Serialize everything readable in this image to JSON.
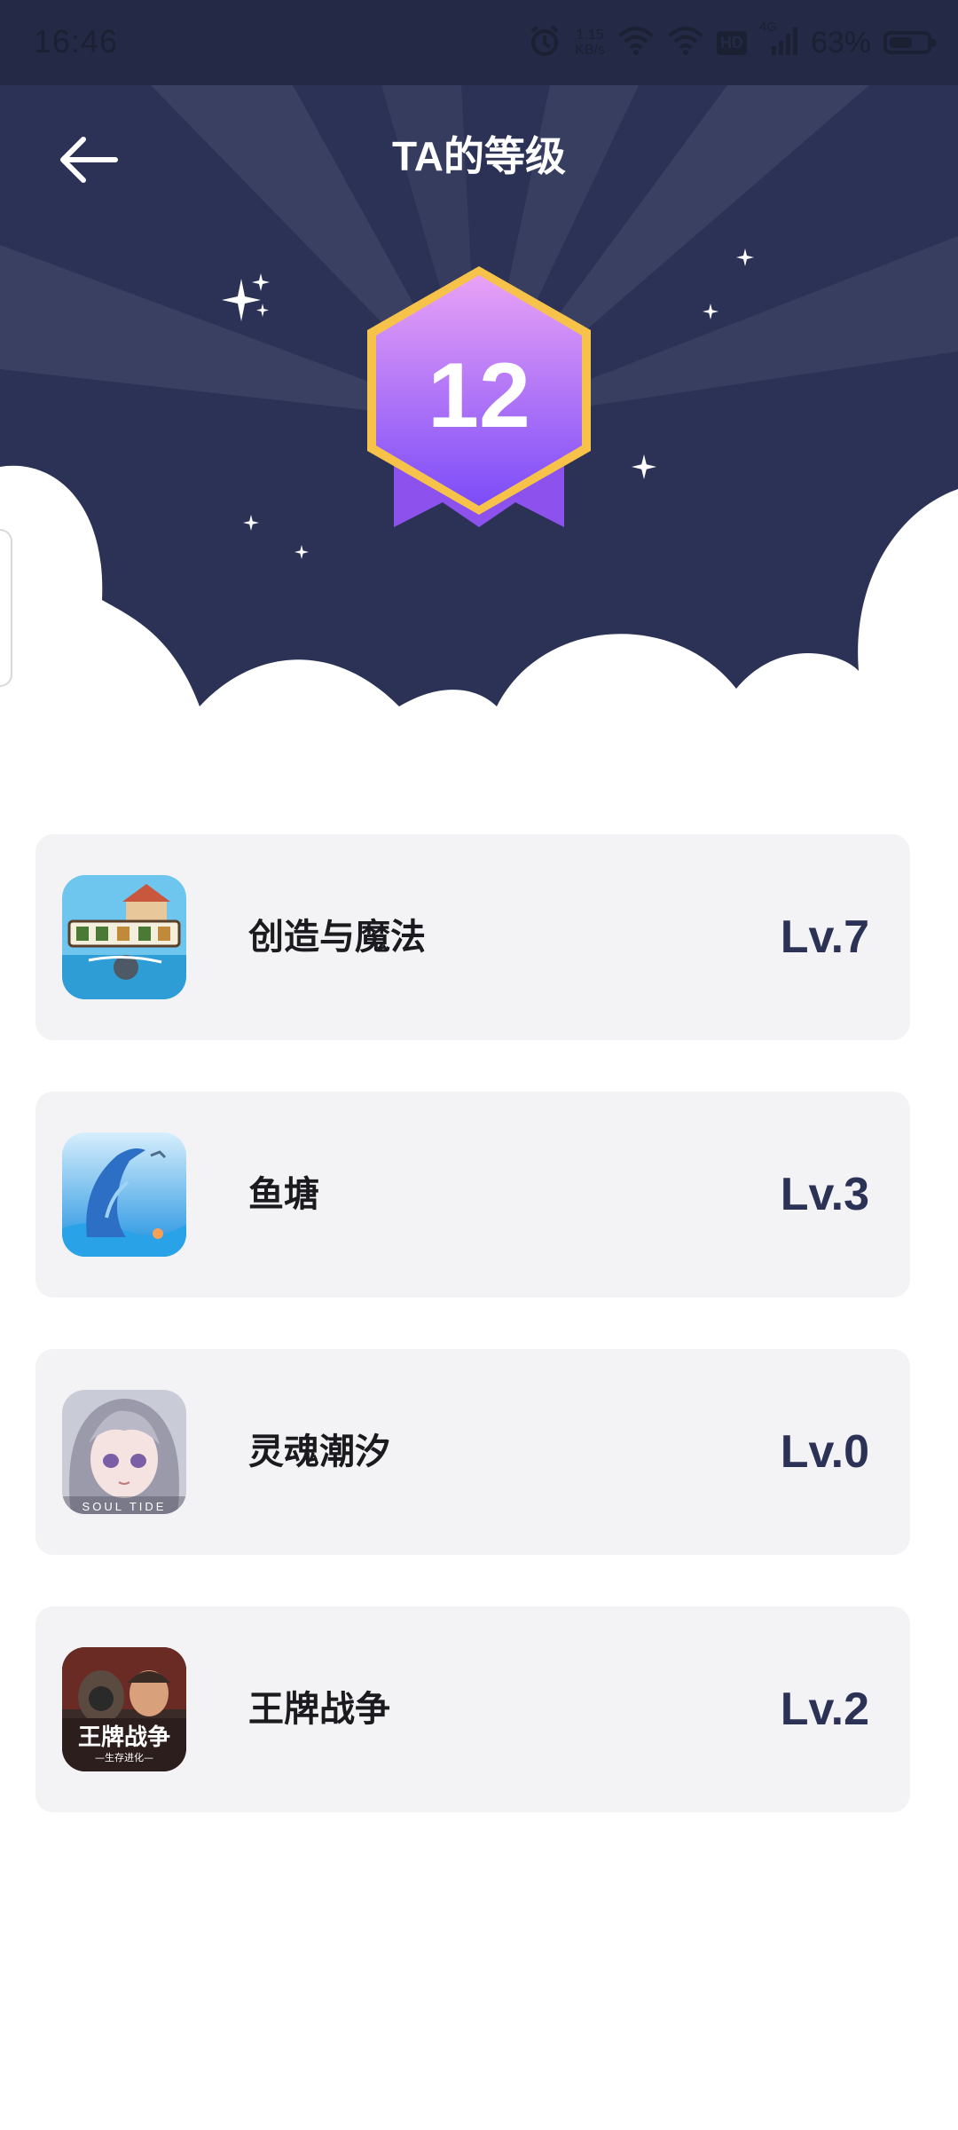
{
  "status_bar": {
    "time": "16:46",
    "network_speed_value": "1.15",
    "network_speed_unit": "KB/s",
    "hd_label": "HD",
    "signal_label": "4G",
    "battery_percent": "63%",
    "battery_level": 0.63
  },
  "header": {
    "title": "TA的等级",
    "back_icon": "arrow-left-icon",
    "level_badge": {
      "value": "12",
      "gradient_top": "#e79df7",
      "gradient_bottom": "#7b4dfa",
      "border_color": "#f8c449"
    },
    "background_color": "#2b3256"
  },
  "games": [
    {
      "name": "创造与魔法",
      "level": "Lv.7",
      "icon": "creation-and-magic-game-icon"
    },
    {
      "name": "鱼塘",
      "level": "Lv.3",
      "icon": "fish-pond-dolphin-game-icon"
    },
    {
      "name": "灵魂潮汐",
      "level": "Lv.0",
      "icon": "soul-tide-game-icon",
      "icon_caption": "SOUL TIDE"
    },
    {
      "name": "王牌战争",
      "level": "Lv.2",
      "icon": "ace-war-game-icon",
      "icon_caption": "王牌战争",
      "icon_subcaption": "—生存进化—"
    }
  ],
  "colors": {
    "card_background": "#f3f3f5",
    "level_text": "#2b3256"
  }
}
